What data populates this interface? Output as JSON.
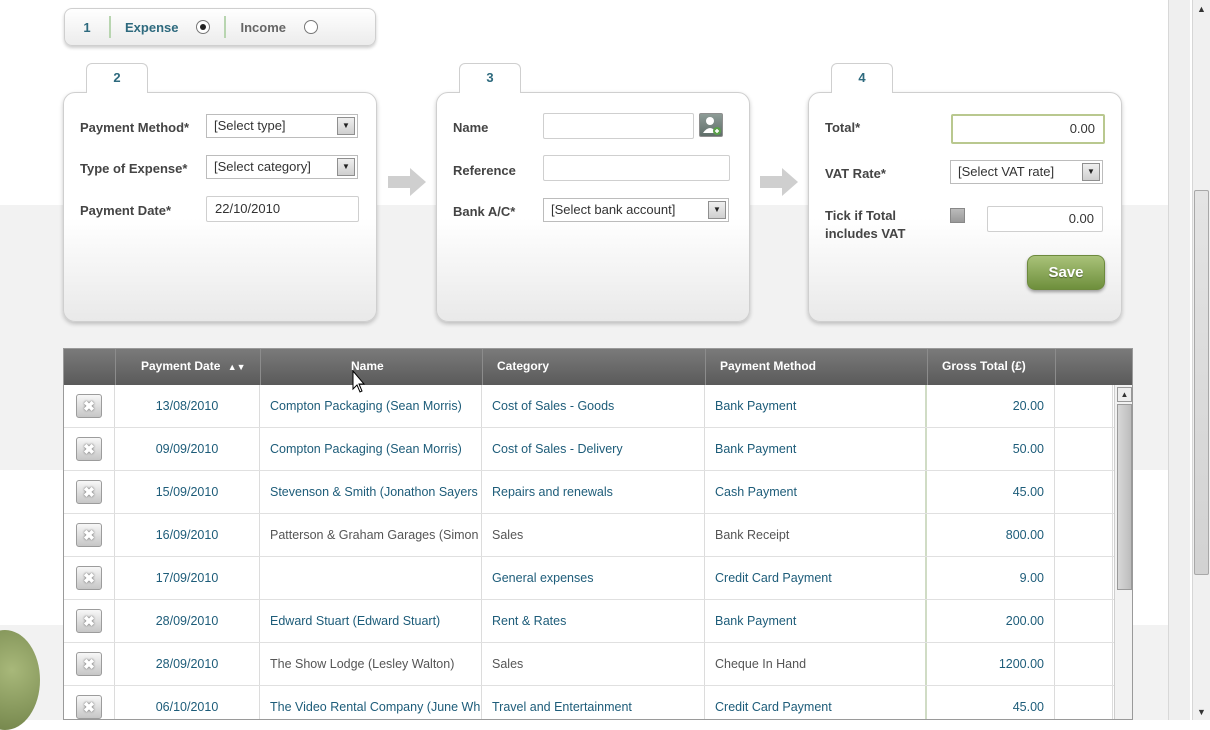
{
  "step1": {
    "number": "1",
    "expense_label": "Expense",
    "income_label": "Income",
    "selected": "expense"
  },
  "step2": {
    "number": "2",
    "payment_method_label": "Payment Method*",
    "payment_method_value": "[Select type]",
    "type_label": "Type of Expense*",
    "type_value": "[Select category]",
    "date_label": "Payment Date*",
    "date_value": "22/10/2010"
  },
  "step3": {
    "number": "3",
    "name_label": "Name",
    "name_value": "",
    "reference_label": "Reference",
    "reference_value": "",
    "bank_label": "Bank A/C*",
    "bank_value": "[Select bank account]"
  },
  "step4": {
    "number": "4",
    "total_label": "Total*",
    "total_value": "0.00",
    "vat_label": "VAT Rate*",
    "vat_value": "[Select VAT rate]",
    "tick_label_1": "Tick if Total",
    "tick_label_2": "includes VAT",
    "vat_amount": "0.00",
    "save_label": "Save"
  },
  "table": {
    "headers": [
      "Payment Date",
      "Name",
      "Category",
      "Payment Method",
      "Gross Total (£)"
    ],
    "rows": [
      {
        "date": "13/08/2010",
        "name": "Compton Packaging (Sean Morris)",
        "category": "Cost of Sales - Goods",
        "method": "Bank Payment",
        "total": "20.00",
        "muted": false
      },
      {
        "date": "09/09/2010",
        "name": "Compton Packaging (Sean Morris)",
        "category": "Cost of Sales - Delivery",
        "method": "Bank Payment",
        "total": "50.00",
        "muted": false
      },
      {
        "date": "15/09/2010",
        "name": "Stevenson & Smith (Jonathon Sayers",
        "category": "Repairs and renewals",
        "method": "Cash Payment",
        "total": "45.00",
        "muted": false
      },
      {
        "date": "16/09/2010",
        "name": "Patterson & Graham Garages (Simon",
        "category": "Sales",
        "method": "Bank Receipt",
        "total": "800.00",
        "muted": true
      },
      {
        "date": "17/09/2010",
        "name": "",
        "category": "General expenses",
        "method": "Credit Card Payment",
        "total": "9.00",
        "muted": false
      },
      {
        "date": "28/09/2010",
        "name": "Edward Stuart (Edward Stuart)",
        "category": "Rent & Rates",
        "method": "Bank Payment",
        "total": "200.00",
        "muted": false
      },
      {
        "date": "28/09/2010",
        "name": "The Show Lodge (Lesley Walton)",
        "category": "Sales",
        "method": "Cheque In Hand",
        "total": "1200.00",
        "muted": true
      },
      {
        "date": "06/10/2010",
        "name": "The Video Rental Company (June Wh",
        "category": "Travel and Entertainment",
        "method": "Credit Card Payment",
        "total": "45.00",
        "muted": false
      }
    ]
  },
  "colors": {
    "accent": "#2e6a7e",
    "link_text": "#1d5c79",
    "save_green": "#6e8f3c",
    "header_grey": "#5a5a5a"
  }
}
